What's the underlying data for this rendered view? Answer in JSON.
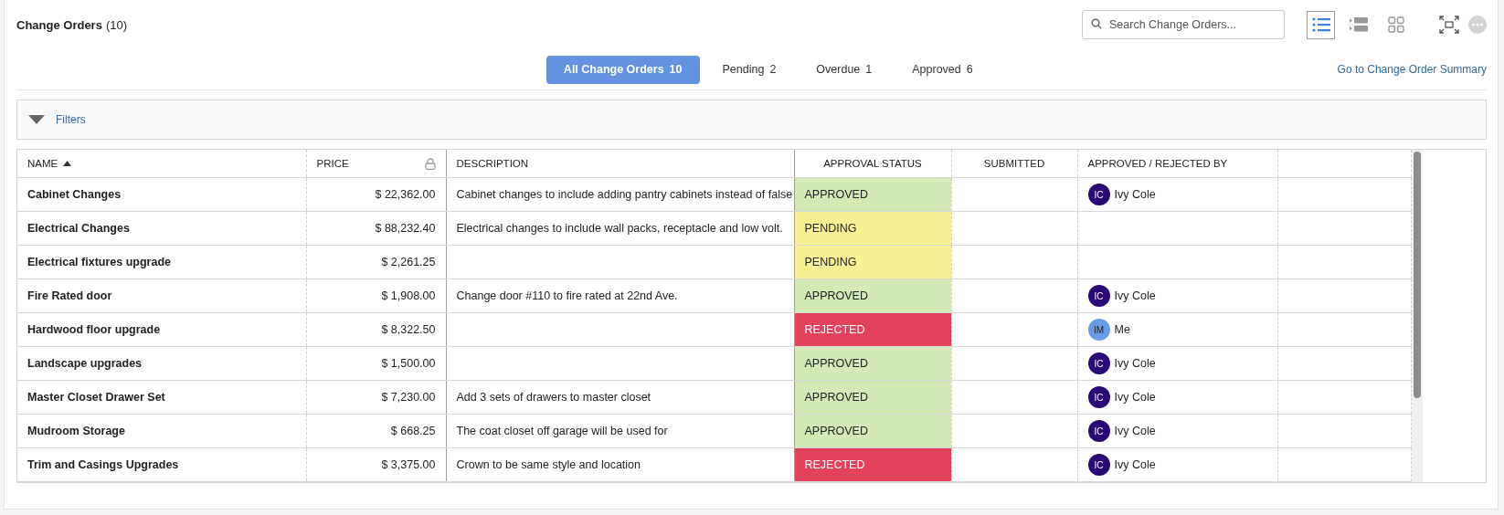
{
  "header": {
    "title": "Change Orders",
    "count": "(10)"
  },
  "search": {
    "placeholder": "Search Change Orders..."
  },
  "view_buttons": [
    {
      "kind": "list",
      "selected": true
    },
    {
      "kind": "rows",
      "selected": false
    },
    {
      "kind": "grid",
      "selected": false
    }
  ],
  "tabs": [
    {
      "label": "All Change Orders",
      "count": "10",
      "selected": true
    },
    {
      "label": "Pending",
      "count": "2",
      "selected": false
    },
    {
      "label": "Overdue",
      "count": "1",
      "selected": false
    },
    {
      "label": "Approved",
      "count": "6",
      "selected": false
    }
  ],
  "summary_link": "Go to Change Order Summary",
  "filters": {
    "label": "Filters",
    "expanded": false
  },
  "table": {
    "columns": [
      {
        "label": "NAME",
        "sorted": true
      },
      {
        "label": "PRICE",
        "locked": true
      },
      {
        "label": "DESCRIPTION"
      },
      {
        "label": "APPROVAL STATUS"
      },
      {
        "label": "SUBMITTED"
      },
      {
        "label": "APPROVED / REJECTED BY"
      }
    ],
    "rows": [
      {
        "name": "Cabinet Changes",
        "price": "$ 22,362.00",
        "description": "Cabinet changes to include adding pantry cabinets instead of false",
        "status": {
          "kind": "approved",
          "label": "APPROVED"
        },
        "approver": {
          "initials": "IC",
          "name": "Ivy Cole",
          "color": "#2a0a78"
        }
      },
      {
        "name": "Electrical Changes",
        "price": "$ 88,232.40",
        "description": "Electrical changes to include wall packs, receptacle and low volt.",
        "status": {
          "kind": "pending",
          "label": "PENDING"
        }
      },
      {
        "name": "Electrical fixtures upgrade",
        "price": "$ 2,261.25",
        "status": {
          "kind": "pending",
          "label": "PENDING"
        }
      },
      {
        "name": "Fire Rated door",
        "price": "$ 1,908.00",
        "description": "Change door #110 to fire rated at 22nd Ave.",
        "status": {
          "kind": "approved",
          "label": "APPROVED"
        },
        "approver": {
          "initials": "IC",
          "name": "Ivy Cole",
          "color": "#2a0a78"
        }
      },
      {
        "name": "Hardwood floor upgrade",
        "price": "$ 8,322.50",
        "status": {
          "kind": "rejected",
          "label": "REJECTED"
        },
        "approver": {
          "initials": "IM",
          "name": "Me",
          "color": "#6a9be8"
        }
      },
      {
        "name": "Landscape upgrades",
        "price": "$ 1,500.00",
        "status": {
          "kind": "approved",
          "label": "APPROVED"
        },
        "approver": {
          "initials": "IC",
          "name": "Ivy Cole",
          "color": "#2a0a78"
        }
      },
      {
        "name": "Master Closet Drawer Set",
        "price": "$ 7,230.00",
        "description": "Add 3 sets of drawers to master closet",
        "status": {
          "kind": "approved",
          "label": "APPROVED"
        },
        "approver": {
          "initials": "IC",
          "name": "Ivy Cole",
          "color": "#2a0a78"
        }
      },
      {
        "name": "Mudroom Storage",
        "price": "$ 668.25",
        "description": "The coat closet off garage will be used for",
        "status": {
          "kind": "approved",
          "label": "APPROVED"
        },
        "approver": {
          "initials": "IC",
          "name": "Ivy Cole",
          "color": "#2a0a78"
        }
      },
      {
        "name": "Trim and Casings Upgrades",
        "price": "$ 3,375.00",
        "description": "Crown to be same style and location",
        "status": {
          "kind": "rejected",
          "label": "REJECTED"
        },
        "approver": {
          "initials": "IC",
          "name": "Ivy Cole",
          "color": "#2a0a78"
        }
      }
    ]
  }
}
